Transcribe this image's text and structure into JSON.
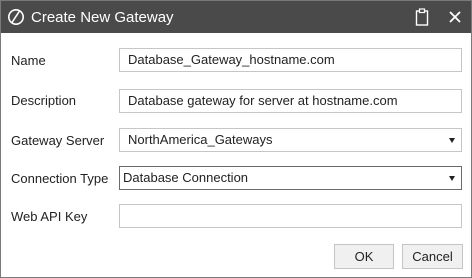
{
  "window": {
    "title": "Create New Gateway",
    "icons": {
      "logo": "circle-slash-logo",
      "clipboard": "clipboard-icon",
      "close": "close-icon"
    }
  },
  "form": {
    "name": {
      "label": "Name",
      "value": "Database_Gateway_hostname.com"
    },
    "description": {
      "label": "Description",
      "value": "Database gateway for server at hostname.com"
    },
    "gateway_server": {
      "label": "Gateway Server",
      "value": "NorthAmerica_Gateways"
    },
    "connection_type": {
      "label": "Connection Type",
      "value": "Database Connection"
    },
    "web_api_key": {
      "label": "Web API Key",
      "value": ""
    }
  },
  "buttons": {
    "ok": "OK",
    "cancel": "Cancel"
  },
  "colors": {
    "titlebar": "#4a4a4a",
    "border": "#c6c6c6",
    "button_bg": "#f0f0f0"
  }
}
